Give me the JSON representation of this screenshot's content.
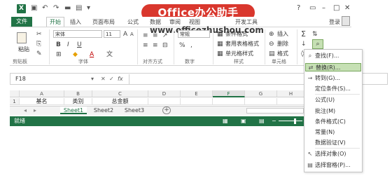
{
  "app": {
    "logo": "X",
    "help": "?",
    "login": "登录"
  },
  "banner": {
    "title": "Office办公助手",
    "url": "www.officezhushou.com"
  },
  "tabs": [
    "文件",
    "开始",
    "插入",
    "页面布局",
    "公式",
    "数据",
    "审阅",
    "视图",
    "开发工具"
  ],
  "ribbon": {
    "clipboard": {
      "paste": "粘贴",
      "label": "剪贴板"
    },
    "font": {
      "name": "宋体",
      "size": "11",
      "label": "字体"
    },
    "align": {
      "label": "对齐方式"
    },
    "number": {
      "format": "常规",
      "label": "数字"
    },
    "styles": {
      "conditional": "条件格式",
      "table": "套用表格格式",
      "cell": "单元格样式",
      "label": "样式"
    },
    "cells": {
      "insert": "插入",
      "delete": "删除",
      "format": "格式",
      "label": "单元格"
    }
  },
  "formula": {
    "name_box": "F18",
    "fx": "fx"
  },
  "grid": {
    "columns": [
      "A",
      "B",
      "C",
      "D",
      "E",
      "F",
      "G",
      "H"
    ],
    "row_number": "1",
    "cells": [
      "基名",
      "类别",
      "总金额"
    ]
  },
  "sheets": [
    "Sheet1",
    "Sheet2",
    "Sheet3"
  ],
  "status": {
    "ready": "就绪"
  },
  "menu": {
    "items": [
      {
        "icon": "find-icon",
        "label": "查找(F)..."
      },
      {
        "icon": "replace-icon",
        "label": "替换(R)..."
      },
      {
        "icon": "goto-icon",
        "label": "转到(G)..."
      },
      {
        "icon": "",
        "label": "定位条件(S)..."
      },
      {
        "icon": "",
        "label": "公式(U)"
      },
      {
        "icon": "",
        "label": "批注(M)"
      },
      {
        "icon": "",
        "label": "条件格式(C)"
      },
      {
        "icon": "",
        "label": "常量(N)"
      },
      {
        "icon": "",
        "label": "数据验证(V)"
      },
      {
        "icon": "select-objects-icon",
        "label": "选择对象(O)"
      },
      {
        "icon": "selection-pane-icon",
        "label": "选择窗格(P)..."
      }
    ]
  },
  "colors": {
    "excel_green": "#217346",
    "banner_red": "#d9372d",
    "highlight": "#c6e0b4"
  }
}
